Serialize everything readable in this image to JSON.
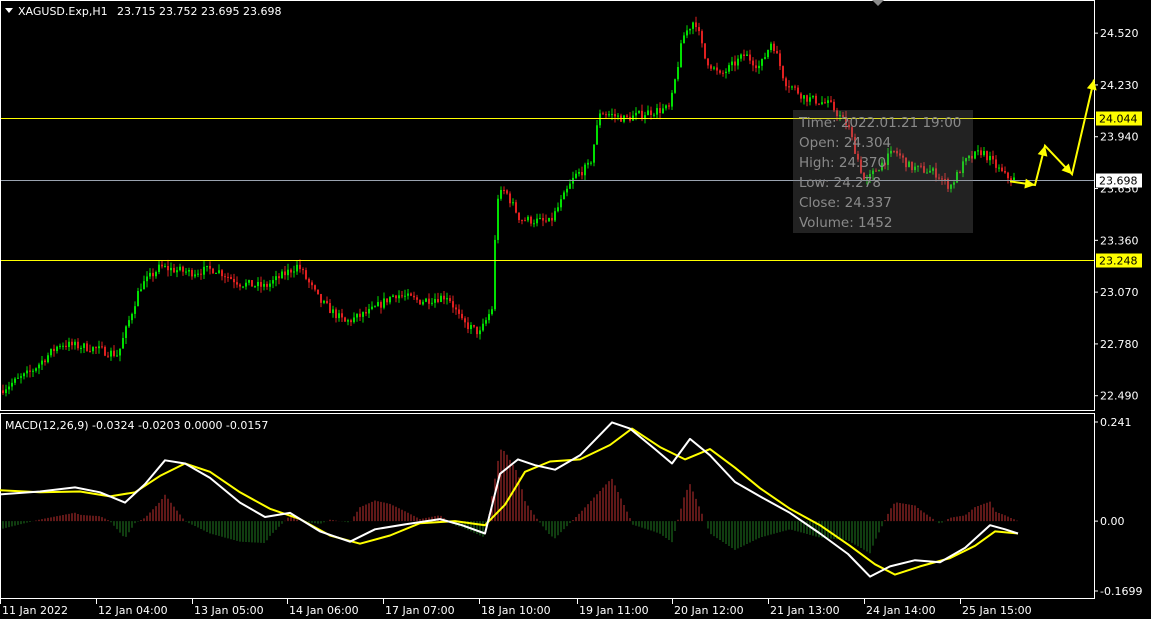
{
  "header": {
    "symbol": "XAGUSD.Exp,H1",
    "ohlc": "23.715 23.752 23.695 23.698"
  },
  "indicator": {
    "label": "MACD(12,26,9) -0.0324 -0.0203 0.0000 -0.0157"
  },
  "colors": {
    "background": "#000000",
    "frame": "#ffffff",
    "bull_candle": "#00e000",
    "bear_candle": "#e02020",
    "level_line": "#ffff00",
    "bid_line": "#9aa3b0",
    "macd_line": "#ffffff",
    "signal_line": "#ffff00",
    "hist_positive": "#c03030",
    "hist_negative": "#1f7a1f",
    "arrow": "#ffff00"
  },
  "chart_data": [
    {
      "type": "candlestick",
      "symbol": "XAGUSD.Exp",
      "timeframe": "H1",
      "ylim": [
        22.41,
        24.7
      ],
      "y_ticks": [
        "24.520",
        "24.230",
        "23.940",
        "23.650",
        "23.360",
        "23.070",
        "22.780",
        "22.490"
      ],
      "x_ticks": [
        "11 Jan 2022",
        "12 Jan 04:00",
        "13 Jan 05:00",
        "14 Jan 06:00",
        "17 Jan 07:00",
        "18 Jan 10:00",
        "19 Jan 11:00",
        "20 Jan 12:00",
        "21 Jan 13:00",
        "24 Jan 14:00",
        "25 Jan 15:00"
      ],
      "close_path_anchors": [
        [
          0,
          22.52
        ],
        [
          30,
          22.62
        ],
        [
          60,
          22.78
        ],
        [
          90,
          22.76
        ],
        [
          118,
          22.72
        ],
        [
          140,
          23.1
        ],
        [
          160,
          23.21
        ],
        [
          190,
          23.18
        ],
        [
          215,
          23.2
        ],
        [
          240,
          23.12
        ],
        [
          265,
          23.1
        ],
        [
          298,
          23.22
        ],
        [
          320,
          23.02
        ],
        [
          345,
          22.9
        ],
        [
          370,
          22.96
        ],
        [
          395,
          23.06
        ],
        [
          420,
          23.02
        ],
        [
          448,
          23.05
        ],
        [
          462,
          22.9
        ],
        [
          480,
          22.84
        ],
        [
          492,
          22.98
        ],
        [
          497,
          23.6
        ],
        [
          505,
          23.64
        ],
        [
          520,
          23.48
        ],
        [
          550,
          23.46
        ],
        [
          575,
          23.72
        ],
        [
          590,
          23.78
        ],
        [
          600,
          24.08
        ],
        [
          625,
          24.04
        ],
        [
          650,
          24.08
        ],
        [
          670,
          24.1
        ],
        [
          683,
          24.5
        ],
        [
          695,
          24.6
        ],
        [
          705,
          24.38
        ],
        [
          720,
          24.28
        ],
        [
          745,
          24.4
        ],
        [
          760,
          24.33
        ],
        [
          772,
          24.48
        ],
        [
          785,
          24.25
        ],
        [
          805,
          24.16
        ],
        [
          830,
          24.12
        ],
        [
          848,
          24.0
        ],
        [
          865,
          23.68
        ],
        [
          880,
          23.78
        ],
        [
          895,
          23.86
        ],
        [
          910,
          23.77
        ],
        [
          935,
          23.74
        ],
        [
          950,
          23.66
        ],
        [
          965,
          23.8
        ],
        [
          982,
          23.86
        ],
        [
          995,
          23.78
        ],
        [
          1005,
          23.72
        ],
        [
          1015,
          23.7
        ]
      ],
      "price_lines": [
        {
          "label": "24.044",
          "value": 24.044,
          "kind": "level"
        },
        {
          "label": "23.698",
          "value": 23.698,
          "kind": "bid"
        },
        {
          "label": "23.248",
          "value": 23.248,
          "kind": "level"
        }
      ],
      "tooltip": {
        "time": "Time: 2022.01.21 19:00",
        "open": "Open: 24.304",
        "high": "High: 24.370",
        "low": "Low: 24.278",
        "close": "Close: 24.337",
        "volume": "Volume: 1452"
      },
      "projection_arrow": [
        [
          1010,
          23.69
        ],
        [
          1035,
          23.67
        ],
        [
          1045,
          23.89
        ],
        [
          1072,
          23.73
        ],
        [
          1094,
          24.26
        ]
      ]
    },
    {
      "type": "line",
      "title": "MACD(12,26,9) -0.0324 -0.0203 0.0000 -0.0157",
      "ylim": [
        -0.1699,
        0.241
      ],
      "y_ticks": [
        "0.241",
        "0.00",
        "-0.1699"
      ],
      "series": [
        {
          "role": "macd",
          "points": [
            [
              0,
              0.065
            ],
            [
              40,
              0.072
            ],
            [
              75,
              0.082
            ],
            [
              100,
              0.07
            ],
            [
              125,
              0.045
            ],
            [
              145,
              0.09
            ],
            [
              165,
              0.148
            ],
            [
              185,
              0.14
            ],
            [
              210,
              0.105
            ],
            [
              240,
              0.045
            ],
            [
              265,
              0.01
            ],
            [
              290,
              0.02
            ],
            [
              320,
              -0.025
            ],
            [
              350,
              -0.05
            ],
            [
              375,
              -0.02
            ],
            [
              405,
              -0.008
            ],
            [
              440,
              0.005
            ],
            [
              462,
              -0.01
            ],
            [
              485,
              -0.03
            ],
            [
              500,
              0.115
            ],
            [
              518,
              0.15
            ],
            [
              535,
              0.136
            ],
            [
              555,
              0.125
            ],
            [
              580,
              0.16
            ],
            [
              600,
              0.21
            ],
            [
              612,
              0.24
            ],
            [
              630,
              0.225
            ],
            [
              655,
              0.175
            ],
            [
              672,
              0.14
            ],
            [
              690,
              0.2
            ],
            [
              710,
              0.16
            ],
            [
              735,
              0.095
            ],
            [
              760,
              0.06
            ],
            [
              790,
              0.02
            ],
            [
              820,
              -0.03
            ],
            [
              848,
              -0.08
            ],
            [
              870,
              -0.135
            ],
            [
              890,
              -0.11
            ],
            [
              915,
              -0.095
            ],
            [
              940,
              -0.1
            ],
            [
              965,
              -0.065
            ],
            [
              990,
              -0.01
            ],
            [
              1005,
              -0.02
            ],
            [
              1018,
              -0.03
            ]
          ]
        },
        {
          "role": "signal",
          "points": [
            [
              0,
              0.075
            ],
            [
              40,
              0.07
            ],
            [
              80,
              0.072
            ],
            [
              110,
              0.06
            ],
            [
              135,
              0.07
            ],
            [
              160,
              0.11
            ],
            [
              185,
              0.14
            ],
            [
              210,
              0.12
            ],
            [
              240,
              0.07
            ],
            [
              270,
              0.03
            ],
            [
              300,
              0.005
            ],
            [
              330,
              -0.035
            ],
            [
              360,
              -0.055
            ],
            [
              390,
              -0.035
            ],
            [
              420,
              -0.005
            ],
            [
              455,
              0.0
            ],
            [
              485,
              -0.01
            ],
            [
              505,
              0.04
            ],
            [
              525,
              0.12
            ],
            [
              550,
              0.145
            ],
            [
              580,
              0.15
            ],
            [
              610,
              0.185
            ],
            [
              632,
              0.225
            ],
            [
              660,
              0.18
            ],
            [
              685,
              0.15
            ],
            [
              710,
              0.175
            ],
            [
              735,
              0.13
            ],
            [
              760,
              0.08
            ],
            [
              790,
              0.03
            ],
            [
              820,
              -0.01
            ],
            [
              850,
              -0.06
            ],
            [
              875,
              -0.105
            ],
            [
              895,
              -0.13
            ],
            [
              920,
              -0.11
            ],
            [
              950,
              -0.09
            ],
            [
              975,
              -0.06
            ],
            [
              995,
              -0.025
            ],
            [
              1018,
              -0.03
            ]
          ]
        }
      ]
    }
  ]
}
